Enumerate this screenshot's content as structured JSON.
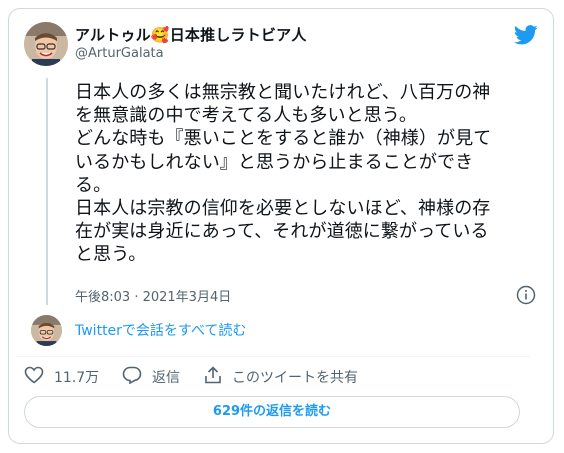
{
  "author": {
    "display_name": "アルトゥル🥰日本推しラトビア人",
    "handle": "@ArturGalata"
  },
  "tweet": {
    "text": "日本人の多くは無宗教と聞いたけれど、八百万の神\nを無意識の中で考えてる人も多いと思う。\nどんな時も『悪いことをすると誰か（神様）が見て\nいるかもしれない』と思うから止まることができ\nる。\n日本人は宗教の信仰を必要としないほど、神様の存\n在が実は身近にあって、それが道徳に繋がっている\nと思う。",
    "timestamp": "午後8:03 · 2021年3月4日"
  },
  "thread_link": "Twitterで会話をすべて読む",
  "actions": {
    "like_count": "11.7万",
    "reply_label": "返信",
    "share_label": "このツイートを共有"
  },
  "read_replies_button": "629件の返信を読む",
  "colors": {
    "accent": "#1d9bf0",
    "secondary_text": "#536471",
    "border": "#cfd9de"
  },
  "icons": [
    "twitter-bird-icon",
    "info-icon",
    "heart-icon",
    "reply-icon",
    "share-icon"
  ]
}
